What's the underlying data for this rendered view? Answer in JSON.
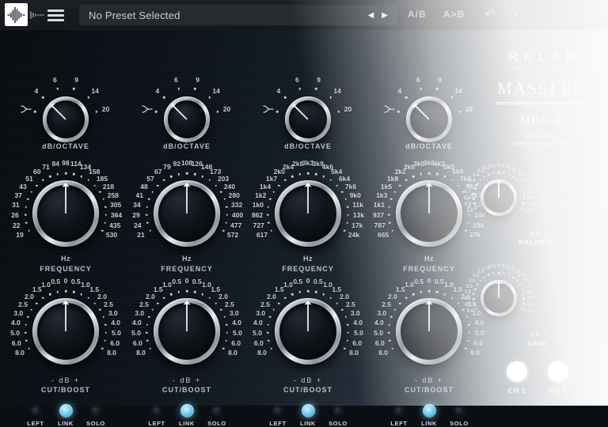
{
  "toolbar": {
    "preset_selected": "No Preset Selected",
    "prev_icon": "◀",
    "next_icon": "▶",
    "ab_compare_label": "A/B",
    "ab_copy_label": "A>B",
    "undo_icon": "↶",
    "redo_icon": "↷"
  },
  "captions": {
    "slope": "dB/OCTAVE",
    "frequency": "FREQUENCY",
    "hz": "Hz",
    "cut_boost": "CUT/BOOST",
    "db_scale": "- dB +",
    "balance": "BALANCE",
    "gain": "GAIN"
  },
  "led": {
    "labels": [
      "LEFT",
      "LINK",
      "SOLO"
    ],
    "active": "LINK"
  },
  "channel_buttons": {
    "ch1": "CH 1",
    "ch2": "CH 2"
  },
  "branding": {
    "brand": "RELAB",
    "brand_sub": "DEVELOPMENT",
    "series": "MASELEC",
    "model": "MEA-2",
    "tagline1": "precision",
    "tagline2": "stereo equalizer"
  },
  "knobs": {
    "slope": {
      "labels": [
        "SHELF",
        "4",
        "6",
        "9",
        "14",
        "20"
      ],
      "arc": [
        -76,
        76
      ],
      "pointer": -45,
      "value": "4"
    },
    "cut": {
      "labels": [
        "8.0",
        "6.0",
        "5.0",
        "4.0",
        "3.0",
        "2.5",
        "2.0",
        "1.5",
        "1.0",
        "0.5",
        "0",
        "0.5",
        "1.0",
        "1.5",
        "2.0",
        "2.5",
        "3.0",
        "4.0",
        "5.0",
        "6.0",
        "8.0"
      ],
      "arc": [
        -115,
        115
      ],
      "pointer": 0,
      "value": "0"
    },
    "freq_band_1": {
      "labels": [
        "19",
        "22",
        "26",
        "31",
        "37",
        "43",
        "51",
        "60",
        "71",
        "84",
        "98",
        "114",
        "134",
        "158",
        "185",
        "218",
        "258",
        "305",
        "364",
        "435",
        "530"
      ],
      "arc": [
        -115,
        115
      ],
      "pointer": 0,
      "value": "98"
    },
    "freq_band_2": {
      "labels": [
        "21",
        "24",
        "29",
        "34",
        "41",
        "48",
        "57",
        "67",
        "79",
        "92",
        "108",
        "126",
        "148",
        "173",
        "203",
        "240",
        "280",
        "332",
        "400",
        "477",
        "572"
      ],
      "arc": [
        -115,
        115
      ],
      "pointer": 0,
      "value": "108"
    },
    "freq_band_3": {
      "labels": [
        "617",
        "727",
        "862",
        "1k0",
        "1k2",
        "1k4",
        "1k7",
        "2k0",
        "2k4",
        "2k8",
        "3k3",
        "3k9",
        "4k6",
        "5k4",
        "6k4",
        "7k6",
        "9k0",
        "11k",
        "13k",
        "17k",
        "24k"
      ],
      "arc": [
        -115,
        115
      ],
      "pointer": 0,
      "value": "3k3"
    },
    "freq_band_4": {
      "labels": [
        "665",
        "787",
        "937",
        "1k1",
        "1k3",
        "1k5",
        "1k8",
        "2k2",
        "2k6",
        "3k0",
        "3k6",
        "4k2",
        "5k0",
        "5k9",
        "7k0",
        "8k2",
        "9k7",
        "12k",
        "14k",
        "19k",
        "27k"
      ],
      "arc": [
        -115,
        115
      ],
      "pointer": 0,
      "value": "3k6"
    },
    "balance": {
      "labels": [
        "1.0",
        "0.9",
        "0.8",
        "0.7",
        "0.6",
        "0.5",
        "0.4",
        "0.3",
        "0.2",
        "0.1",
        "0",
        "0.1",
        "0.2",
        "0.3",
        "0.4",
        "0.5",
        "0.6",
        "0.7",
        "0.8",
        "0.9",
        "1.0"
      ],
      "arc": [
        -115,
        115
      ],
      "pointer": 0,
      "value": "0"
    },
    "gain": {
      "labels": [
        "5.0",
        "4.5",
        "4.0",
        "3.5",
        "3.0",
        "2.5",
        "2.0",
        "1.5",
        "1.0",
        "0.5",
        "0",
        "0.5",
        "1.0",
        "1.5",
        "2.0",
        "2.5",
        "3.0",
        "3.5",
        "4.0",
        "4.5",
        "5.0"
      ],
      "arc": [
        -115,
        115
      ],
      "pointer": 0,
      "value": "0"
    }
  }
}
